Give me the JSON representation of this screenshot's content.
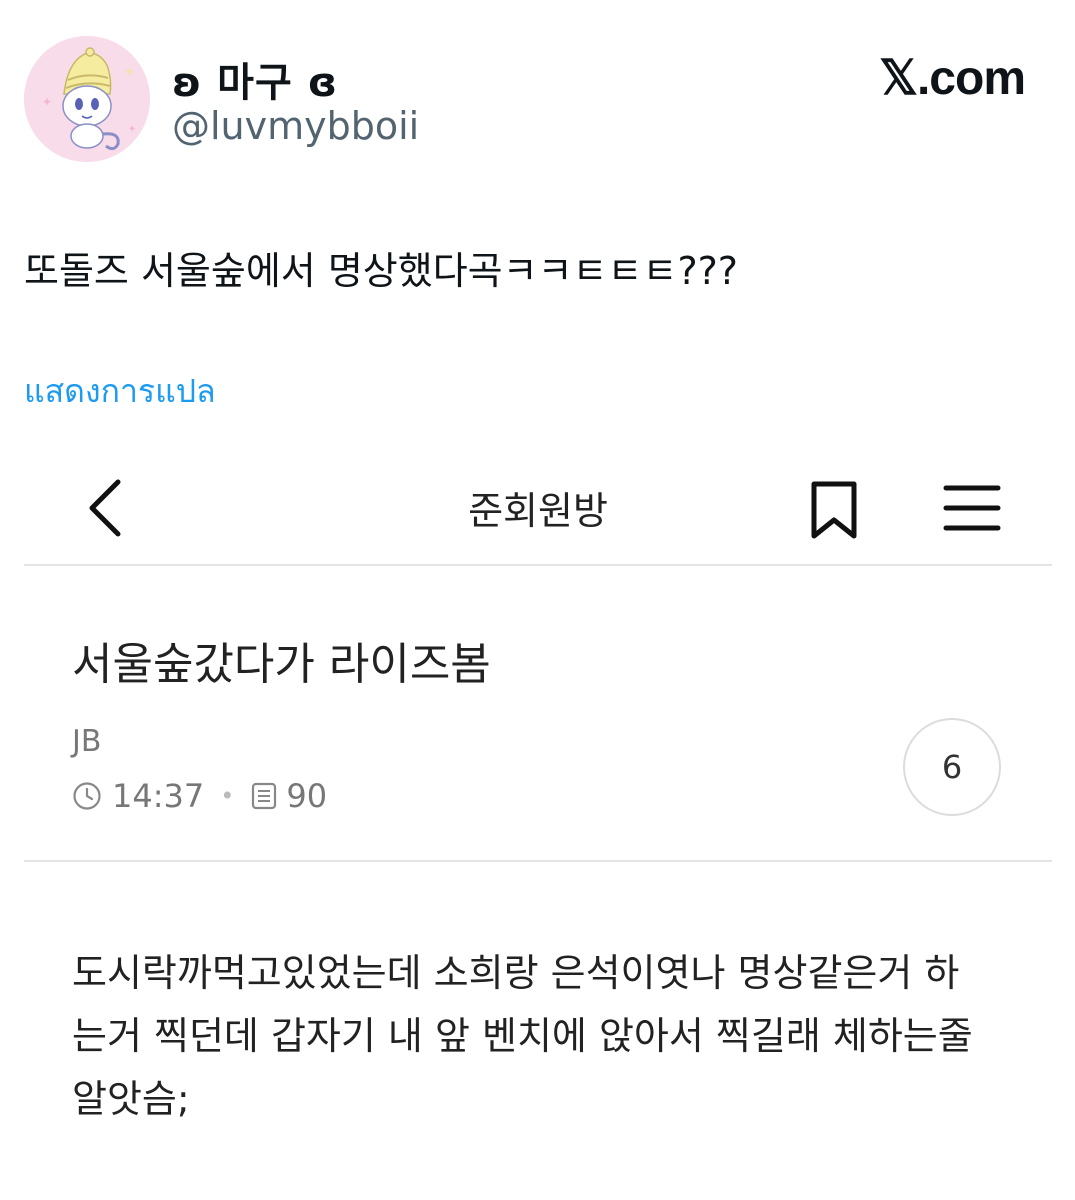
{
  "tweet": {
    "display_name": "ʚ 마구 ɞ",
    "handle": "@luvmybboii",
    "site_logo": "𝕏.com",
    "text": "또돌즈 서울숲에서 명상했다곡ㅋㅋㅌㅌㅌ???",
    "translate_label": "แสดงการแปล",
    "link_color": "#1d9bf0"
  },
  "embedded": {
    "app_bar": {
      "back_icon": "chevron-left-icon",
      "title": "준회원방",
      "bookmark_icon": "bookmark-icon",
      "menu_icon": "hamburger-menu-icon"
    },
    "post": {
      "title": "서울숲갔다가 라이즈봄",
      "author": "JB",
      "time": "14:37",
      "views": "90",
      "comment_count": "6",
      "body_lines": [
        "도시락까먹고있었는데 소희랑 은석이엿나 명상같은거 하",
        "는거 찍던데 갑자기 내 앞 벤치에 앉아서 찍길래 체하는줄",
        "알앗슴;"
      ]
    }
  }
}
